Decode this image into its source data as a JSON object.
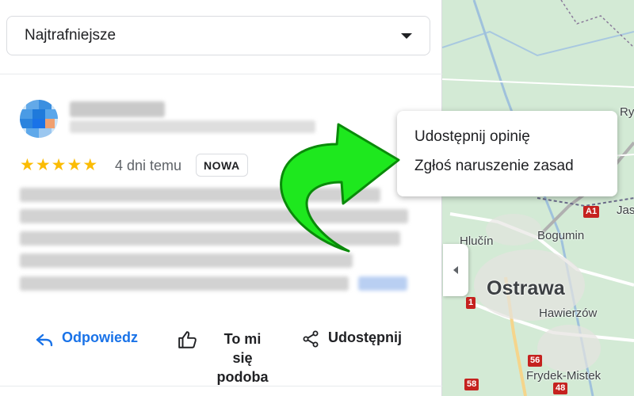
{
  "sort": {
    "label": "Najtrafniejsze"
  },
  "review": {
    "time": "4 dni temu",
    "badge": "NOWA",
    "rating": 5
  },
  "actions": {
    "reply": "Odpowiedz",
    "like_line1": "To mi",
    "like_line2": "się",
    "like_line3": "podoba",
    "share": "Udostępnij"
  },
  "popup_menu": {
    "items": [
      "Udostępnij opinię",
      "Zgłoś naruszenie zasad"
    ]
  },
  "map": {
    "city": "Ostrawa",
    "towns": [
      "Hlučín",
      "Bogumin",
      "Hawierzów",
      "Frydek-Mistek",
      "Jas",
      "Ry"
    ],
    "roads": [
      "A1",
      "1",
      "56",
      "58",
      "48"
    ]
  },
  "colors": {
    "accent": "#1a73e8",
    "star": "#fbbc04",
    "arrow": "#1ee81e"
  }
}
